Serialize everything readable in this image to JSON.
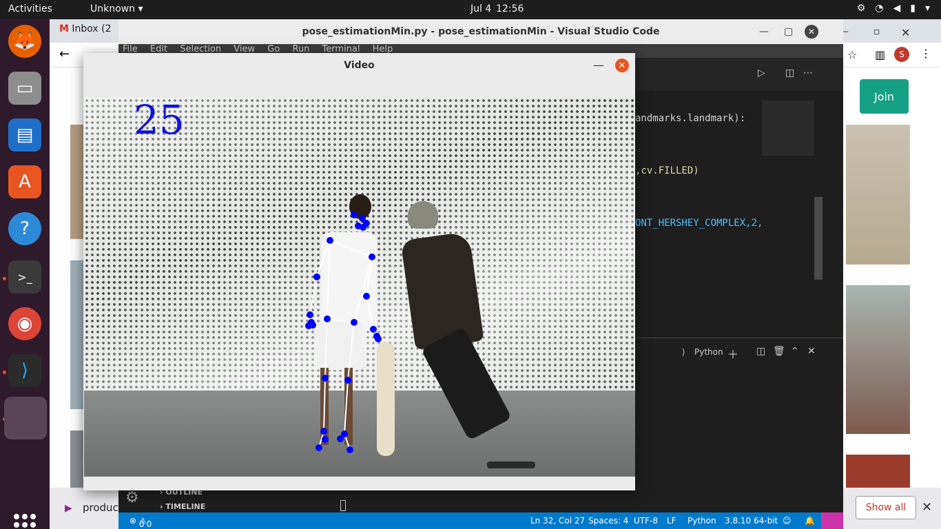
{
  "topbar": {
    "activities": "Activities",
    "app_menu": "Unknown",
    "date": "Jul 4",
    "time": "12:56"
  },
  "dock": {
    "items": [
      "firefox-icon",
      "files-icon",
      "writer-icon",
      "software-icon",
      "help-icon",
      "terminal-icon",
      "chrome-icon",
      "vscode-icon",
      "opencv-window-icon"
    ]
  },
  "browser": {
    "tab_label": "Inbox (2",
    "join_label": "Join",
    "download_item": "produc",
    "show_all": "Show all"
  },
  "vscode": {
    "title": "pose_estimationMin.py - pose_estimationMin - Visual Studio Code",
    "menu": [
      "File",
      "Edit",
      "Selection",
      "View",
      "Go",
      "Run",
      "Terminal",
      "Help"
    ],
    "code_lines": [
      "andmarks.landmark):",
      ",cv.FILLED)",
      "ONT_HERSHEY_COMPLEX,2,"
    ],
    "panel_label": "Python",
    "outline": "OUTLINE",
    "timeline": "TIMELINE",
    "status": {
      "problems": "0",
      "warnings": "0",
      "position": "Ln 32, Col 27",
      "spaces": "Spaces: 4",
      "encoding": "UTF-8",
      "eol": "LF",
      "language": "Python",
      "interpreter": "3.8.10 64-bit"
    }
  },
  "video_window": {
    "title": "Video",
    "fps_value": "25"
  },
  "colors": {
    "landmark": "#0000ff",
    "vscode_status": "#007acc",
    "ubuntu_orange": "#e95420",
    "join_green": "#16a085"
  }
}
